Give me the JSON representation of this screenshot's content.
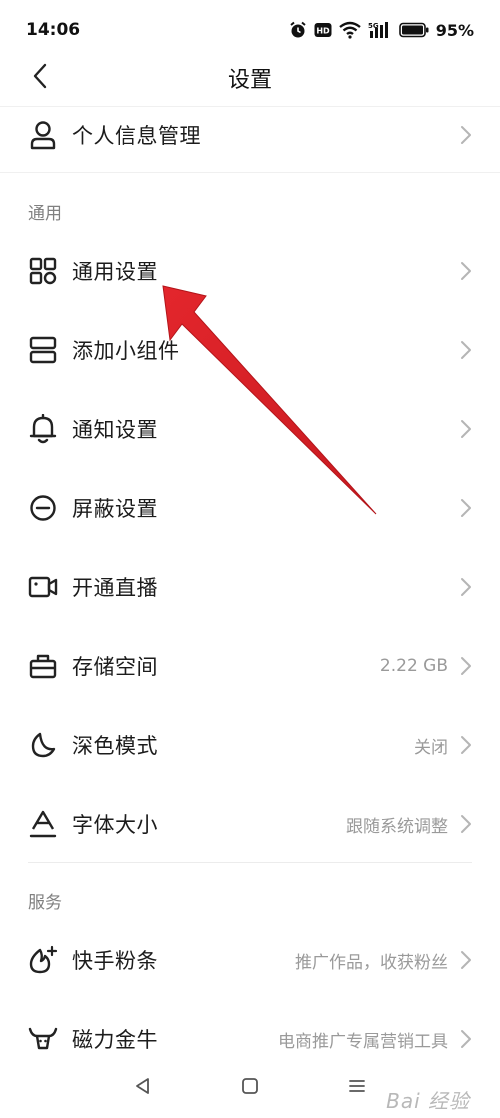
{
  "status_bar": {
    "time": "14:06",
    "network": "5G",
    "battery_percent": "95%"
  },
  "header": {
    "title": "设置"
  },
  "top_items": [
    {
      "label": "个人信息管理",
      "icon": "person-icon"
    }
  ],
  "sections": [
    {
      "header": "通用",
      "items": [
        {
          "label": "通用设置",
          "value": "",
          "icon": "grid-icon"
        },
        {
          "label": "添加小组件",
          "value": "",
          "icon": "widget-icon"
        },
        {
          "label": "通知设置",
          "value": "",
          "icon": "bell-icon"
        },
        {
          "label": "屏蔽设置",
          "value": "",
          "icon": "block-icon"
        },
        {
          "label": "开通直播",
          "value": "",
          "icon": "video-camera-icon"
        },
        {
          "label": "存储空间",
          "value": "2.22 GB",
          "icon": "storage-icon"
        },
        {
          "label": "深色模式",
          "value": "关闭",
          "icon": "moon-icon"
        },
        {
          "label": "字体大小",
          "value": "跟随系统调整",
          "icon": "font-size-icon"
        }
      ]
    },
    {
      "header": "服务",
      "items": [
        {
          "label": "快手粉条",
          "value": "推广作品，收获粉丝",
          "icon": "fire-plus-icon"
        },
        {
          "label": "磁力金牛",
          "value": "电商推广专属营销工具",
          "icon": "bull-icon"
        }
      ]
    }
  ],
  "watermark": "Bai 经验",
  "colors": {
    "annotation_arrow": "#e3262c",
    "chevron": "#b5b5b5",
    "value_text": "#9a9a9a"
  }
}
